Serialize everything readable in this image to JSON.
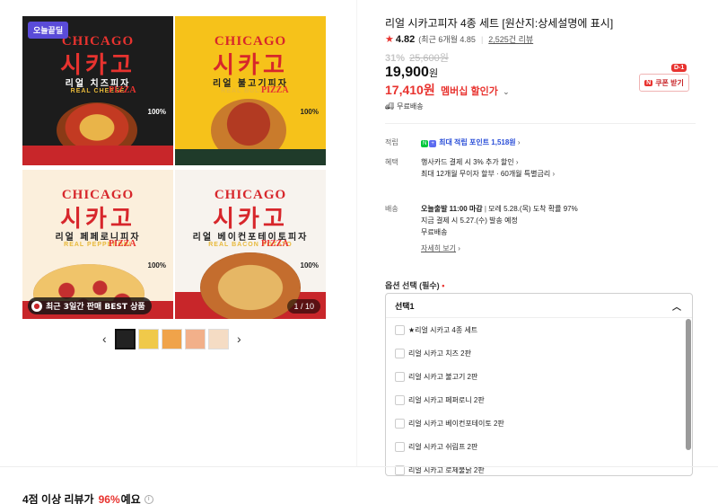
{
  "gallery": {
    "today_badge": "오늘끝딜",
    "best_badge": "최근 3일간 판매 BEST 상품",
    "counter": "1 / 10",
    "tiles": [
      {
        "brand_en": "CHICAGO",
        "brand_ko": "시카고",
        "sub_ko": "리얼 치즈피자",
        "sub_en": "REAL CHEESE",
        "pizza": "PIZZA",
        "percent": "100%"
      },
      {
        "brand_en": "CHICAGO",
        "brand_ko": "시카고",
        "sub_ko": "리얼 불고기피자",
        "sub_en": "REAL BULGOGI",
        "pizza": "PIZZA",
        "percent": "100%"
      },
      {
        "brand_en": "CHICAGO",
        "brand_ko": "시카고",
        "sub_ko": "리얼 페페로니피자",
        "sub_en": "REAL PEPPERONI",
        "pizza": "PIZZA",
        "percent": "100%"
      },
      {
        "brand_en": "CHICAGO",
        "brand_ko": "시카고",
        "sub_ko": "리얼 베이컨포테이토피자",
        "sub_en": "REAL BACON POTATO",
        "pizza": "PIZZA",
        "percent": "100%"
      }
    ],
    "prev_icon": "chevron-left-icon",
    "next_icon": "chevron-right-icon"
  },
  "product": {
    "title": "리얼 시카고피자 4종 세트 [원산지:상세설명에 표시]",
    "rating": "4.82",
    "rating_recent": "(최근 6개월 4.85",
    "review_count": "2,525건 리뷰",
    "discount_rate": "31%",
    "original_price": "25,600원",
    "price": "19,900",
    "price_unit": "원",
    "member_price": "17,410원",
    "member_label": "멤버십 할인가",
    "coupon_tag": "D-1",
    "coupon_label": "쿠폰 받기",
    "free_shipping": "무료배송"
  },
  "benefits": {
    "points_label": "적립",
    "points_value": "최대 적립 포인트 1,518원",
    "card_label": "혜택",
    "card_line1": "행사카드 결제 시 3% 추가 할인",
    "card_line2": "최대 12개월 무이자 할부 · 60개월 특별금리",
    "delivery_label": "배송",
    "delivery_bold": "오늘출발 11:00 마감",
    "delivery_rest": "모레 5.28.(목) 도착 확률 97%",
    "delivery_line2": "지금 결제 시 5.27.(수) 발송 예정",
    "delivery_line3": "무료배송",
    "details_link": "자세히 보기"
  },
  "options": {
    "label": "옵션 선택 (필수)",
    "required_mark": "•",
    "selected": "선택1",
    "items": [
      "★리얼 시카고 4종 세트",
      "리얼 시카고 치즈 2판",
      "리얼 시카고 불고기 2판",
      "리얼 시카고 페퍼로니 2판",
      "리얼 시카고 베이컨포테이토 2판",
      "리얼 시카고 쉬림프 2판",
      "리얼 시카고 로제불닭 2판"
    ]
  },
  "reviews": {
    "summary_prefix": "4점 이상 리뷰가",
    "summary_pct": "96%",
    "summary_suffix": "예요"
  },
  "colors": {
    "accent_red": "#e8332f",
    "link_blue": "#2b4fd8",
    "badge_purple": "#5a4bd8"
  }
}
